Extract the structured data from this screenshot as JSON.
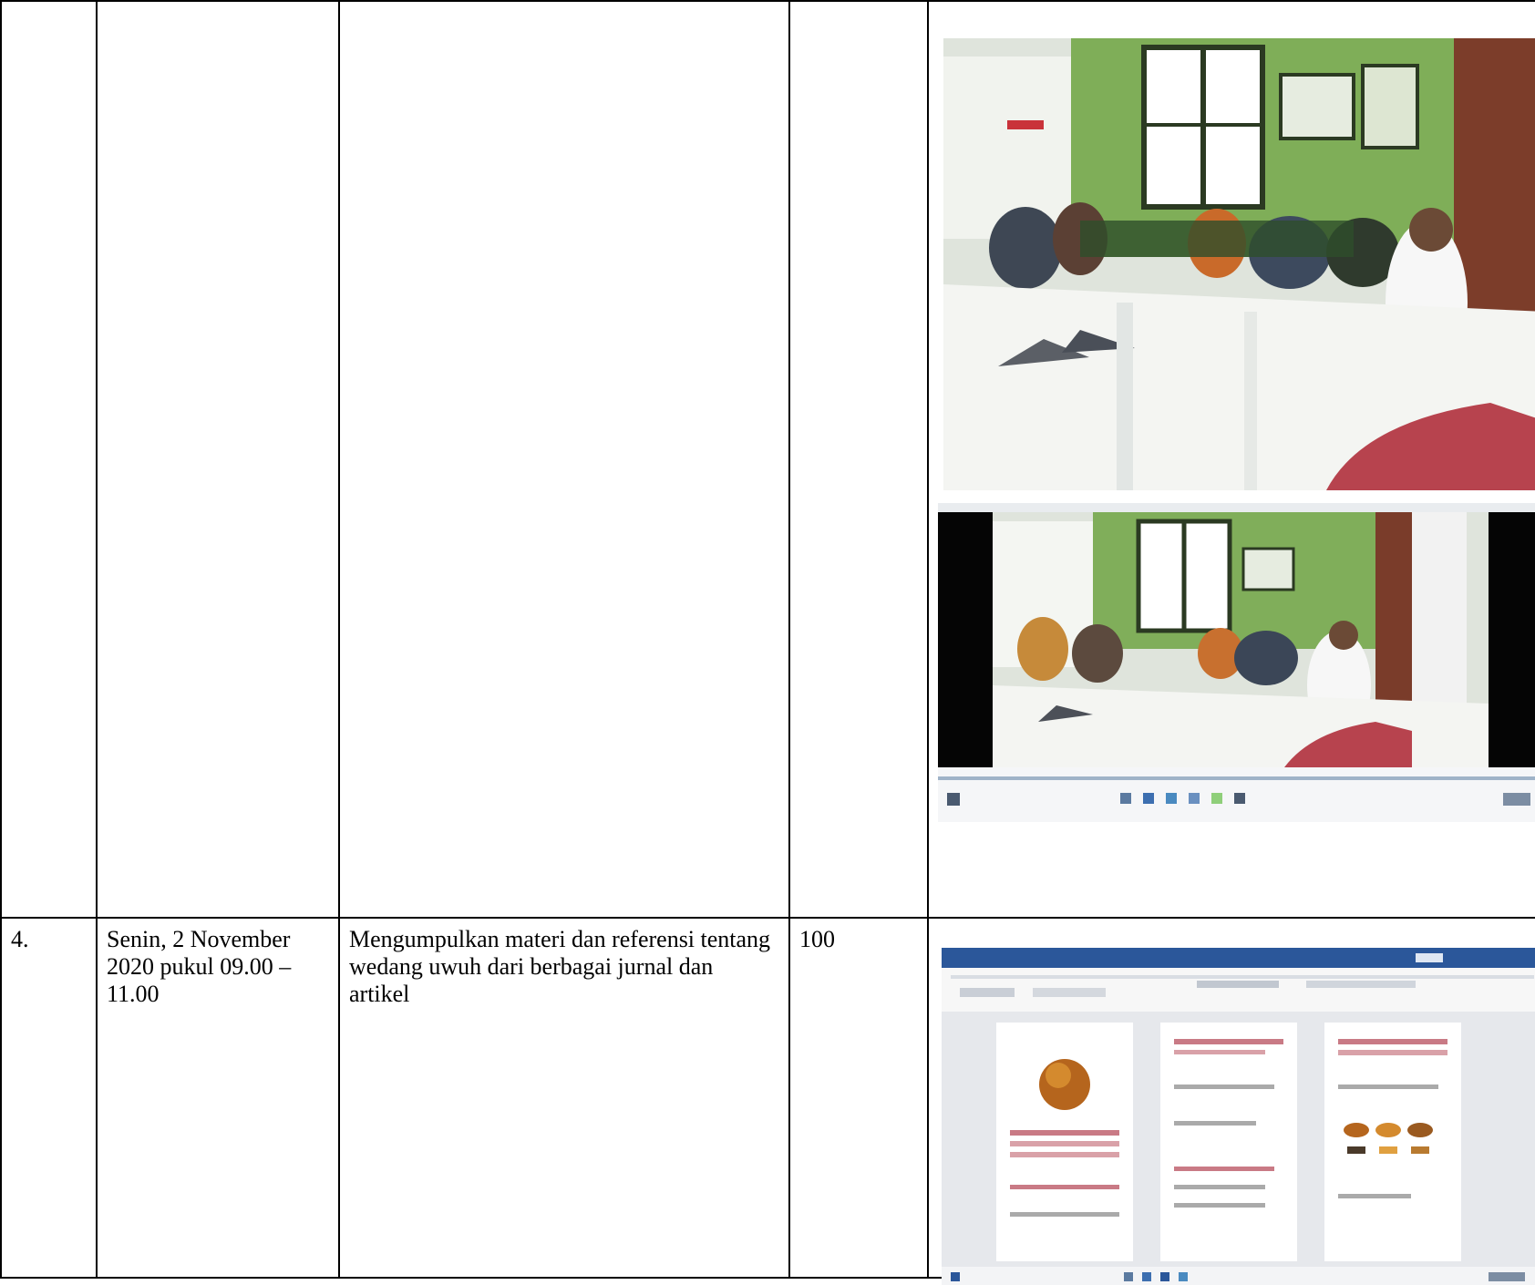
{
  "rows": [
    {
      "no": "",
      "date": "",
      "activity": "",
      "minutes": "",
      "evidence": [
        "photo-mosque-gathering",
        "photo-mosque-gathering-video-player"
      ]
    },
    {
      "no": "4.",
      "date": "Senin, 2 November 2020 pukul 09.00 – 11.00",
      "activity": "Mengumpulkan materi dan referensi tentang wedang uwuh dari berbagai jurnal dan artikel",
      "minutes": "100",
      "evidence": [
        "screenshot-word-document"
      ]
    }
  ]
}
